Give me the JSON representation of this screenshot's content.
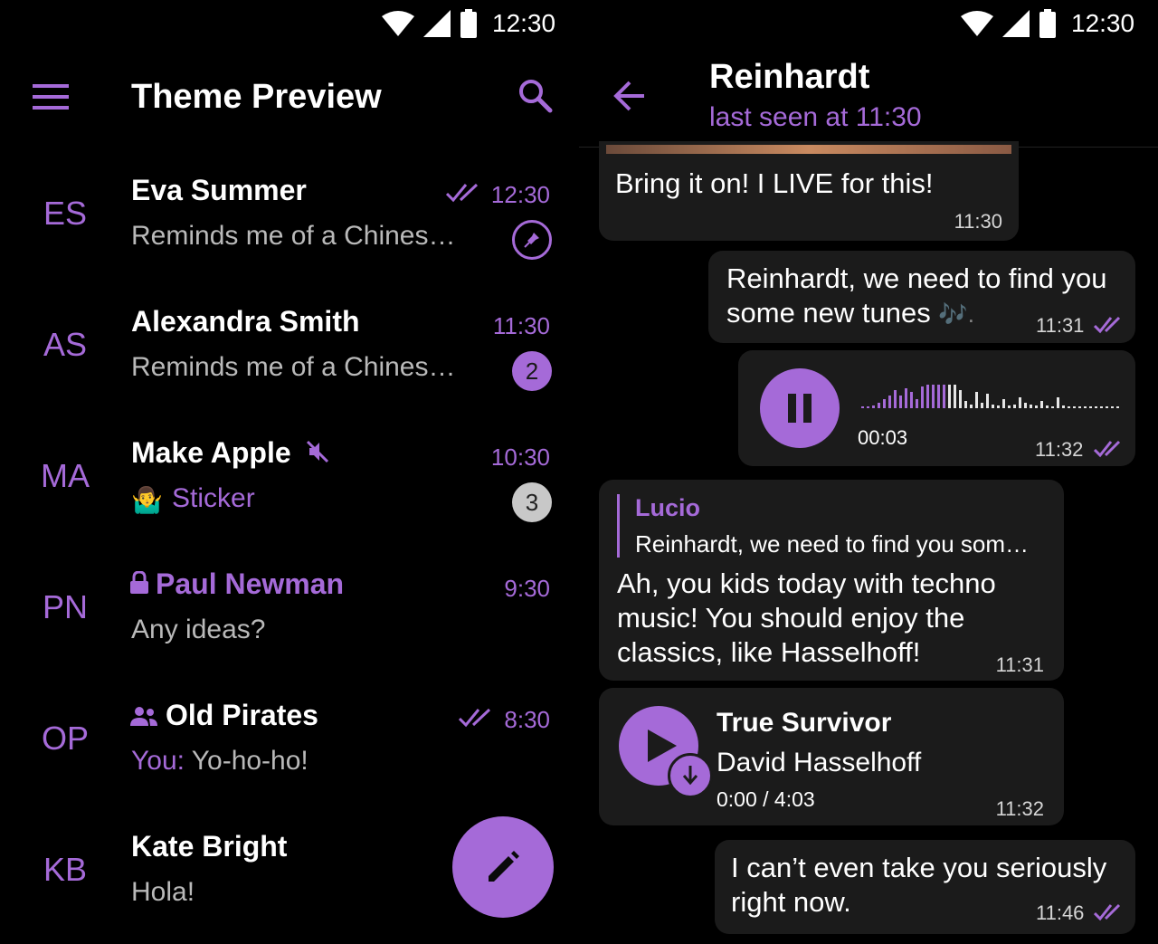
{
  "status_bar": {
    "time": "12:30"
  },
  "chat_list": {
    "title": "Theme Preview",
    "chats": [
      {
        "initials": "ES",
        "name": "Eva Summer",
        "preview": "Reminds me of a Chines…",
        "time": "12:30"
      },
      {
        "initials": "AS",
        "name": "Alexandra Smith",
        "preview": "Reminds me of a Chines…",
        "time": "11:30",
        "unread": "2"
      },
      {
        "initials": "MA",
        "name": "Make Apple",
        "preview": "Sticker",
        "time": "10:30",
        "unread": "3"
      },
      {
        "initials": "PN",
        "name": "Paul Newman",
        "preview": "Any ideas?",
        "time": "9:30"
      },
      {
        "initials": "OP",
        "name": "Old Pirates",
        "preview_prefix": "You:",
        "preview": " Yo-ho-ho!",
        "time": "8:30"
      },
      {
        "initials": "KB",
        "name": "Kate Bright",
        "preview": "Hola!"
      }
    ]
  },
  "conversation": {
    "contact_name": "Reinhardt",
    "contact_status": "last seen at 11:30",
    "messages": [
      {
        "text": "Bring it on! I LIVE for this!",
        "time": "11:30"
      },
      {
        "text_line1": "Reinhardt, we need to find you",
        "text_line2": "some new tunes ",
        "time": "11:31"
      },
      {
        "voice_elapsed": "00:03",
        "time": "11:32"
      },
      {
        "reply_author": "Lucio",
        "reply_text": "Reinhardt, we need to find you som…",
        "line1": "Ah, you kids today with techno",
        "line2": "music! You should enjoy the",
        "line3": "classics, like Hasselhoff!",
        "time": "11:31"
      },
      {
        "track_title": "True Survivor",
        "track_artist": "David Hasselhoff",
        "track_progress": "0:00 / 4:03",
        "time": "11:32"
      },
      {
        "line1": "I can’t even take you seriously",
        "line2": "right now.",
        "time": "11:46"
      }
    ]
  },
  "colors": {
    "accent": "#a56ad8",
    "bubble": "#1b1b1b",
    "background": "#000000"
  }
}
